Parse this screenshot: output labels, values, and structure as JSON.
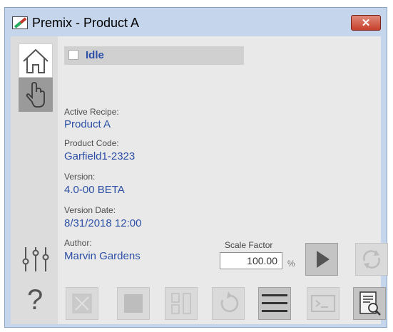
{
  "window": {
    "title": "Premix - Product A",
    "close_symbol": "✕"
  },
  "status": {
    "text": "Idle"
  },
  "details": {
    "active_recipe_label": "Active Recipe:",
    "active_recipe_value": "Product A",
    "product_code_label": "Product Code:",
    "product_code_value": "Garfield1-2323",
    "version_label": "Version:",
    "version_value": "4.0-00 BETA",
    "version_date_label": "Version Date:",
    "version_date_value": "8/31/2018 12:00",
    "author_label": "Author:",
    "author_value": "Marvin Gardens"
  },
  "scale": {
    "label": "Scale Factor",
    "value": "100.00",
    "unit": "%"
  },
  "sidebar": {
    "items": [
      {
        "icon": "home-icon"
      },
      {
        "icon": "hand-icon"
      },
      {
        "icon": "sliders-icon"
      },
      {
        "icon": "help-icon"
      }
    ],
    "help_symbol": "?"
  },
  "toolbar": {
    "buttons": [
      {
        "icon": "abort-icon"
      },
      {
        "icon": "stop-icon"
      },
      {
        "icon": "pause-icon"
      },
      {
        "icon": "reset-icon"
      },
      {
        "icon": "menu-icon"
      },
      {
        "icon": "console-icon"
      },
      {
        "icon": "report-search-icon"
      }
    ]
  },
  "colors": {
    "value_blue": "#2d4fa6",
    "title_bar": "#c5d6ec",
    "close_red": "#c7402c",
    "panel_bg": "#e9e9e9",
    "sidebar_bg": "#dcdcdc"
  }
}
